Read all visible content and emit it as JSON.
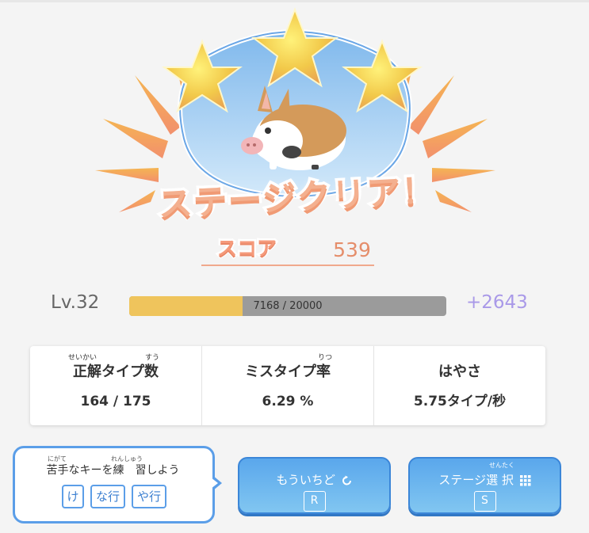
{
  "result": {
    "title": "ステージクリア！",
    "score_label": "スコア",
    "score_value": "539"
  },
  "level": {
    "label": "Lv.32",
    "xp_text": "7168 / 20000",
    "xp_fraction": 0.3584,
    "gain": "+2643"
  },
  "stats": [
    {
      "title": "正解タイプ数",
      "ruby": [
        "せいかい",
        "すう"
      ],
      "value": "164 / 175"
    },
    {
      "title": "ミスタイプ率",
      "ruby": [
        "りつ"
      ],
      "value": "6.29 %"
    },
    {
      "title": "はやさ",
      "ruby": [],
      "value": "5.75タイプ/秒"
    }
  ],
  "practice": {
    "ruby_nigate": "にがて",
    "ruby_renshuu": "れんしゅう",
    "text": "苦手なキーを練　習しよう",
    "chips": [
      "け",
      "な行",
      "や行"
    ]
  },
  "actions": {
    "retry": {
      "label": "もういちど",
      "key": "R",
      "icon": "retry-arrow-icon"
    },
    "stage_select": {
      "label": "ステージ選 択",
      "ruby": "せんたく",
      "key": "S",
      "icon": "grid-icon"
    }
  },
  "colors": {
    "accent_blue": "#5b9ee8",
    "xp_fill": "#efc45c",
    "xp_gain": "#a999e8",
    "score": "#e58e6b"
  }
}
